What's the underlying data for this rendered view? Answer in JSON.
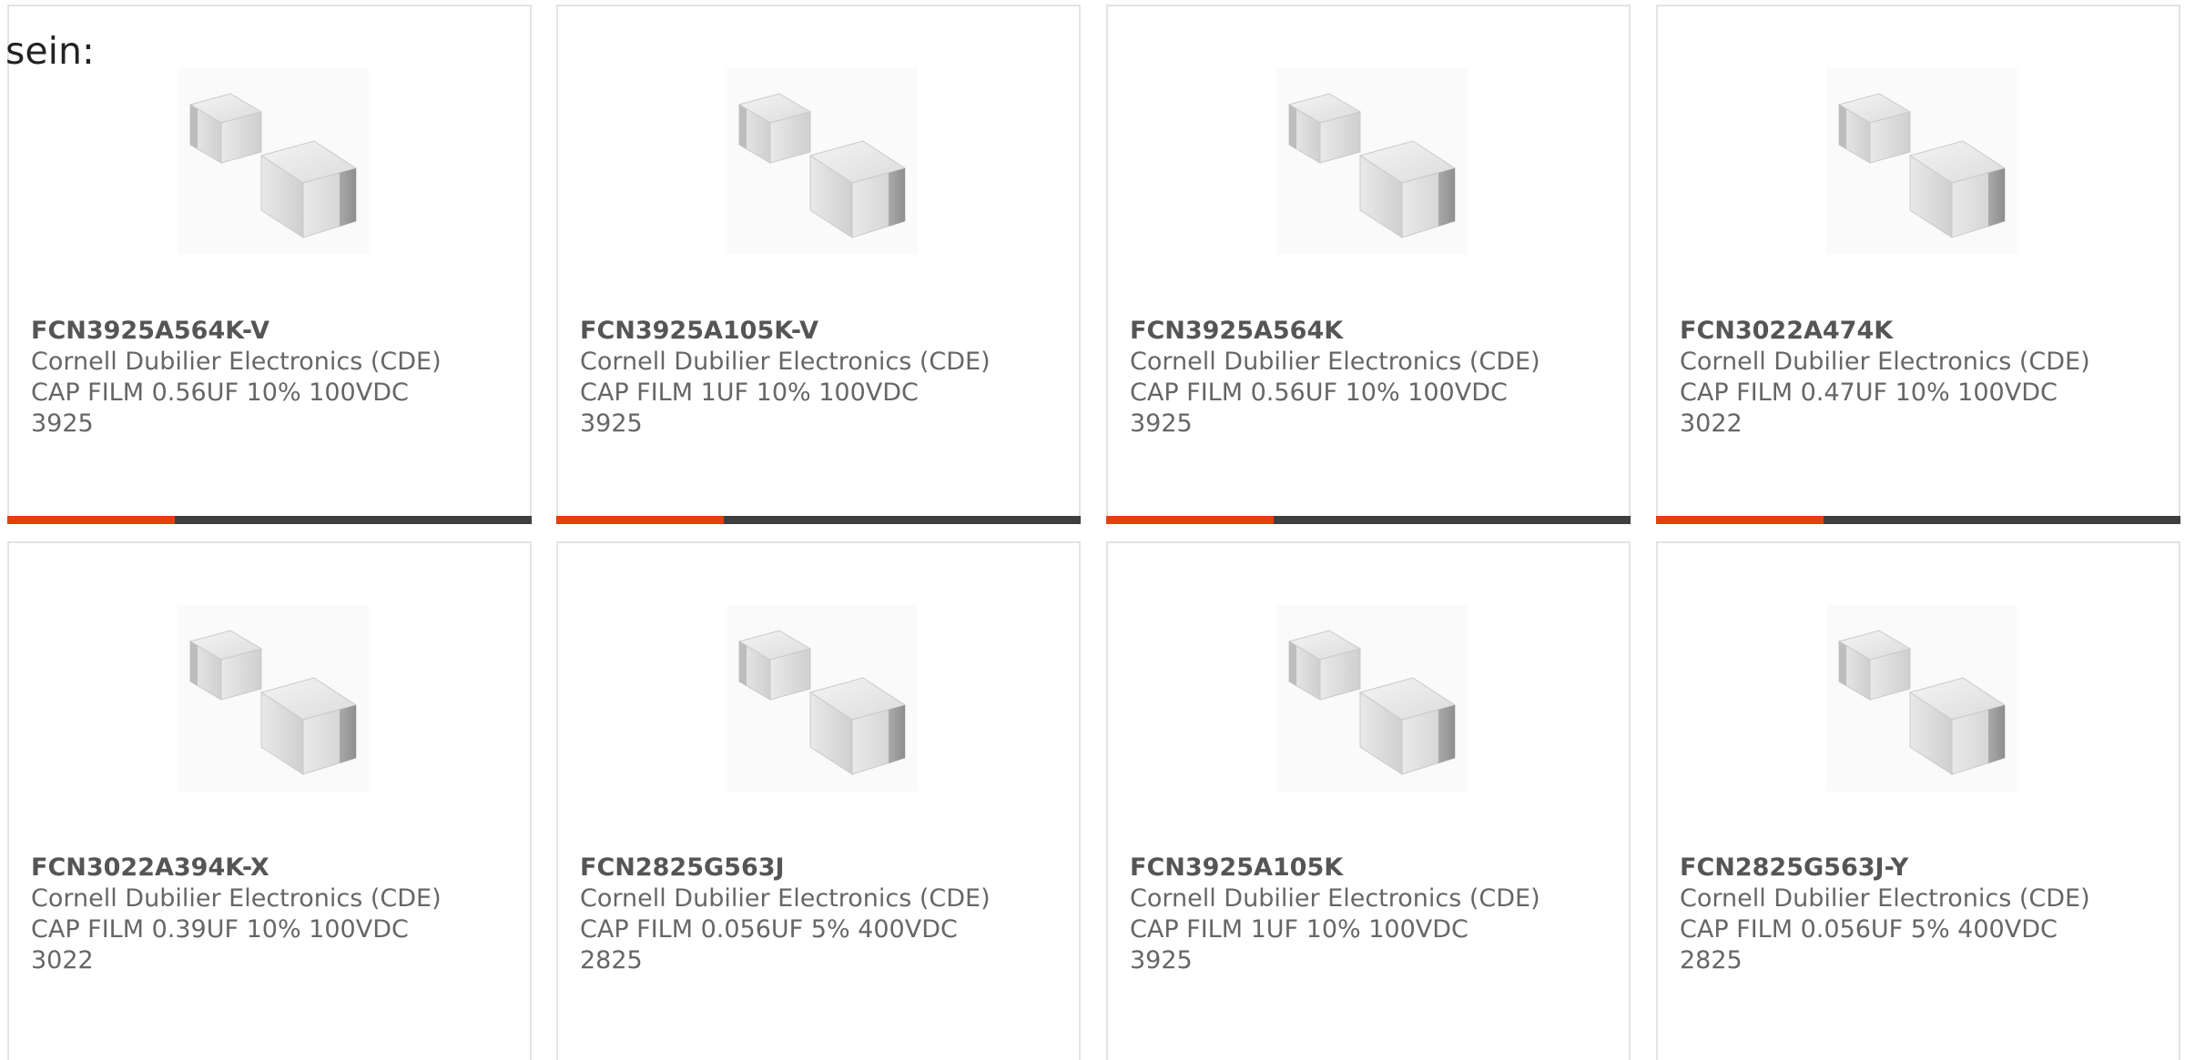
{
  "intro_text": "sein:",
  "colors": {
    "accent": "#e4400e",
    "bar_track": "#3f3f3f",
    "card_border": "#e3e3e3",
    "text": "#666666"
  },
  "products": [
    {
      "part_number": "FCN3925A564K-V",
      "manufacturer": "Cornell Dubilier Electronics (CDE)",
      "description": "CAP FILM 0.56UF 10% 100VDC 3925",
      "image_icon": "film-capacitor-image",
      "progress": 0.32
    },
    {
      "part_number": "FCN3925A105K-V",
      "manufacturer": "Cornell Dubilier Electronics (CDE)",
      "description": "CAP FILM 1UF 10% 100VDC 3925",
      "image_icon": "film-capacitor-image",
      "progress": 0.32
    },
    {
      "part_number": "FCN3925A564K",
      "manufacturer": "Cornell Dubilier Electronics (CDE)",
      "description": "CAP FILM 0.56UF 10% 100VDC 3925",
      "image_icon": "film-capacitor-image",
      "progress": 0.32
    },
    {
      "part_number": "FCN3022A474K",
      "manufacturer": "Cornell Dubilier Electronics (CDE)",
      "description": "CAP FILM 0.47UF 10% 100VDC 3022",
      "image_icon": "film-capacitor-image",
      "progress": 0.32
    },
    {
      "part_number": "FCN3022A394K-X",
      "manufacturer": "Cornell Dubilier Electronics (CDE)",
      "description": "CAP FILM 0.39UF 10% 100VDC 3022",
      "image_icon": "film-capacitor-image"
    },
    {
      "part_number": "FCN2825G563J",
      "manufacturer": "Cornell Dubilier Electronics (CDE)",
      "description": "CAP FILM 0.056UF 5% 400VDC 2825",
      "image_icon": "film-capacitor-image"
    },
    {
      "part_number": "FCN3925A105K",
      "manufacturer": "Cornell Dubilier Electronics (CDE)",
      "description": "CAP FILM 1UF 10% 100VDC 3925",
      "image_icon": "film-capacitor-image"
    },
    {
      "part_number": "FCN2825G563J-Y",
      "manufacturer": "Cornell Dubilier Electronics (CDE)",
      "description": "CAP FILM 0.056UF 5% 400VDC 2825",
      "image_icon": "film-capacitor-image"
    }
  ]
}
